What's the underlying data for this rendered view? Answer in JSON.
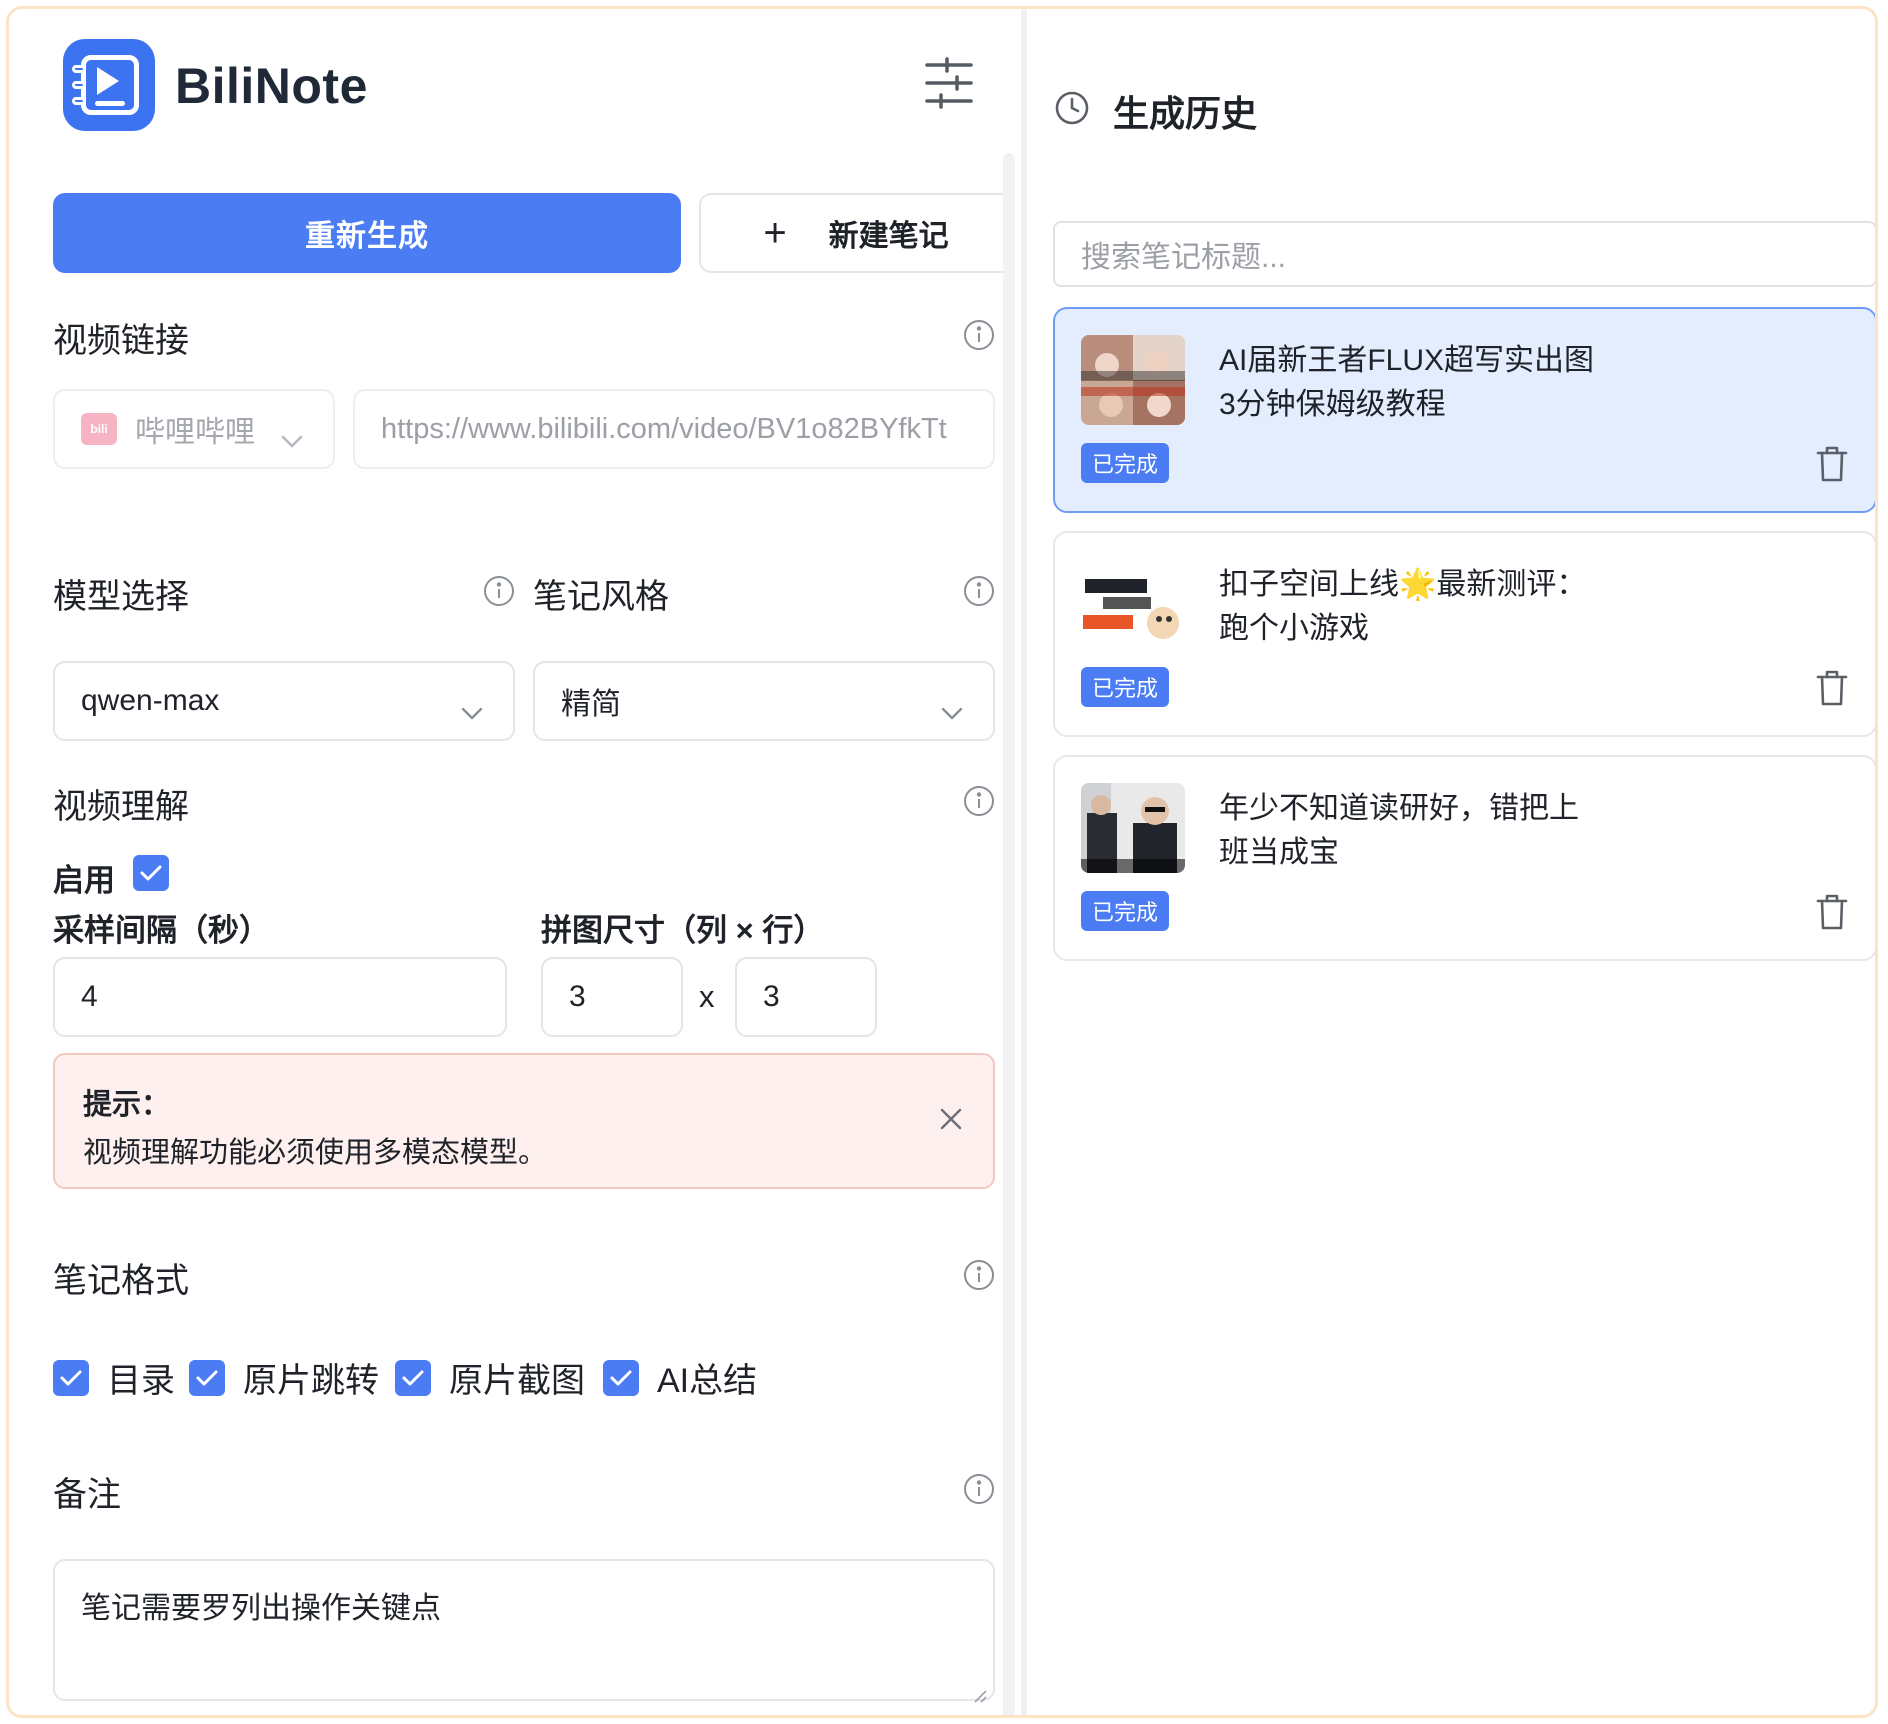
{
  "app": {
    "brand": "BiliNote"
  },
  "actions": {
    "regenerate_label": "重新生成",
    "new_note_label": "新建笔记",
    "new_note_icon": "plus-icon"
  },
  "video_link": {
    "title": "视频链接",
    "platform": "哔哩哔哩",
    "platform_badge": "bilibili",
    "url_value": "https://www.bilibili.com/video/BV1o82BYfkTt"
  },
  "model": {
    "title": "模型选择",
    "selected": "qwen-max"
  },
  "style": {
    "title": "笔记风格",
    "selected": "精简"
  },
  "video_understanding": {
    "title": "视频理解",
    "enable_label": "启用",
    "enabled": true,
    "interval_label": "采样间隔（秒）",
    "interval_value": "4",
    "grid_label": "拼图尺寸（列 × 行）",
    "grid_cols": "3",
    "grid_x": "x",
    "grid_rows": "3"
  },
  "alert": {
    "title": "提示：",
    "message": "视频理解功能必须使用多模态模型。"
  },
  "note_format": {
    "title": "笔记格式",
    "options": [
      {
        "label": "目录",
        "checked": true
      },
      {
        "label": "原片跳转",
        "checked": true
      },
      {
        "label": "原片截图",
        "checked": true
      },
      {
        "label": "AI总结",
        "checked": true
      }
    ]
  },
  "remark": {
    "title": "备注",
    "value": "笔记需要罗列出操作关键点"
  },
  "history": {
    "title": "生成历史",
    "search_placeholder": "搜索笔记标题...",
    "items": [
      {
        "title_line1": "AI届新王者FLUX超写实出图",
        "title_line2": "3分钟保姆级教程",
        "status": "已完成",
        "active": true
      },
      {
        "title_line1": "扣子空间上线🌟最新测评：",
        "title_line2": "跑个小游戏",
        "status": "已完成",
        "active": false
      },
      {
        "title_line1": "年少不知道读研好，错把上",
        "title_line2": "班当成宝",
        "status": "已完成",
        "active": false
      }
    ]
  },
  "colors": {
    "accent": "#4b7cf3",
    "active_card_bg": "#e3edfd",
    "alert_bg": "#fdf0ee",
    "frame_border": "#fbe3c6"
  }
}
